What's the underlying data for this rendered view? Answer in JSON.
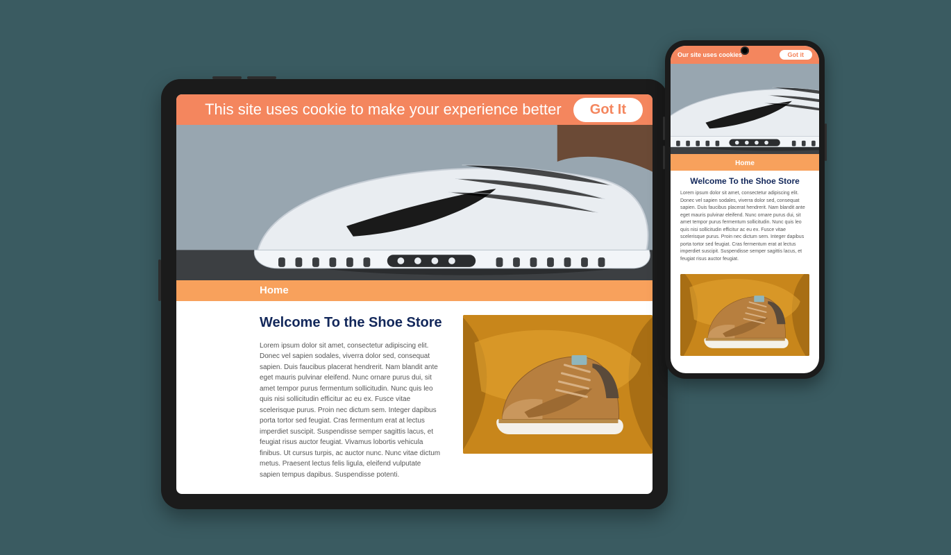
{
  "colors": {
    "background": "#3a5b61",
    "accent": "#f4865e",
    "nav": "#f8a15c",
    "heading": "#12275a"
  },
  "tablet": {
    "cookie": {
      "message": "This site uses cookie to make your experience better",
      "button": "Got It"
    },
    "nav": {
      "home": "Home"
    },
    "hero_alt": "white-sneaker-hero-photo",
    "article": {
      "title": "Welcome To the Shoe Store",
      "body": "Lorem ipsum dolor sit amet, consectetur adipiscing elit. Donec vel sapien sodales, viverra dolor sed, consequat sapien. Duis faucibus placerat hendrerit. Nam blandit ante eget mauris pulvinar eleifend. Nunc ornare purus dui, sit amet tempor purus fermentum sollicitudin. Nunc quis leo quis nisi sollicitudin efficitur ac eu ex. Fusce vitae scelerisque purus. Proin nec dictum sem. Integer dapibus porta tortor sed feugiat. Cras fermentum erat at lectus imperdiet suscipit. Suspendisse semper sagittis lacus, et feugiat risus auctor feugiat. Vivamus lobortis vehicula finibus. Ut cursus turpis, ac auctor nunc. Nunc vitae dictum metus. Praesent lectus felis ligula, eleifend vulputate sapien tempus dapibus. Suspendisse potenti.",
      "image_alt": "tan-sneaker-on-yellow-fabric"
    }
  },
  "phone": {
    "cookie": {
      "message": "Our site uses cookies",
      "button": "Got it"
    },
    "nav": {
      "home": "Home"
    },
    "hero_alt": "white-sneaker-hero-photo",
    "article": {
      "title": "Welcome To the Shoe Store",
      "body": "Lorem ipsum dolor sit amet, consectetur adipiscing elit. Donec vel sapien sodales, viverra dolor sed, consequat sapien. Duis faucibus placerat hendrerit. Nam blandit ante eget mauris pulvinar eleifend. Nunc ornare purus dui, sit amet tempor purus fermentum sollicitudin. Nunc quis leo quis nisi sollicitudin efficitur ac eu ex. Fusce vitae scelerisque purus. Proin nec dictum sem. Integer dapibus porta tortor sed feugiat. Cras fermentum erat at lectus imperdiet suscipit. Suspendisse semper sagittis lacus, et feugiat risus auctor feugiat.",
      "image_alt": "tan-sneaker-on-yellow-fabric"
    }
  }
}
